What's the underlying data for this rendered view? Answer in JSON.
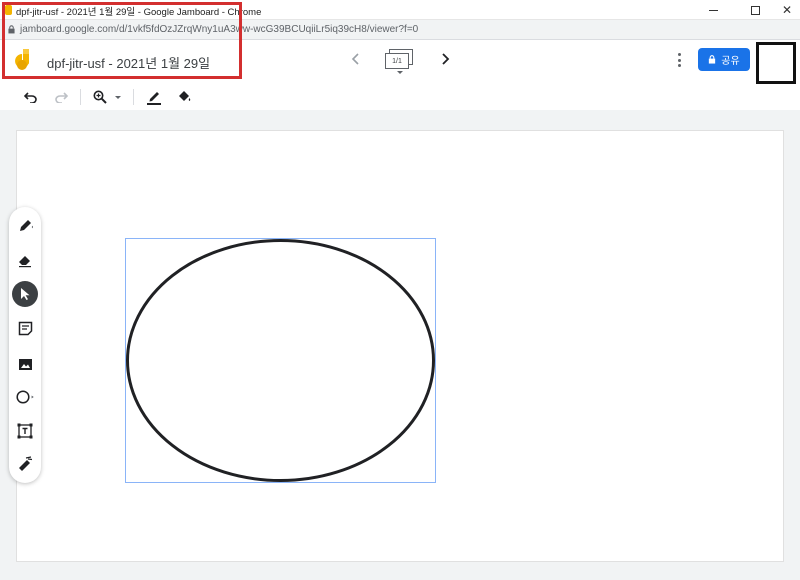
{
  "window": {
    "title": "dpf-jitr-usf - 2021년 1월 29일 - Google Jamboard - Chrome",
    "url": "jamboard.google.com/d/1vkf5fdOzJZrqWny1uA3ww-wcG39BCUqiiLr5iq39cH8/viewer?f=0"
  },
  "header": {
    "doc_title": "dpf-jitr-usf - 2021년 1월 29일",
    "frame_counter": "1/1",
    "share_label": "공유"
  },
  "colors": {
    "accent": "#1a73e8",
    "highlight_box": "#d32f2f",
    "selection": "#8ab4f8",
    "logo": "#f4b400"
  },
  "icons": {
    "toolbar": [
      "undo-icon",
      "redo-icon",
      "zoom-icon",
      "pen-color-icon",
      "fill-color-icon"
    ],
    "rail": [
      "pen-icon",
      "eraser-icon",
      "select-icon",
      "sticky-note-icon",
      "image-icon",
      "shape-circle-icon",
      "text-box-icon",
      "laser-icon"
    ]
  },
  "canvas": {
    "selected_tool": "select",
    "shape": "ellipse"
  }
}
